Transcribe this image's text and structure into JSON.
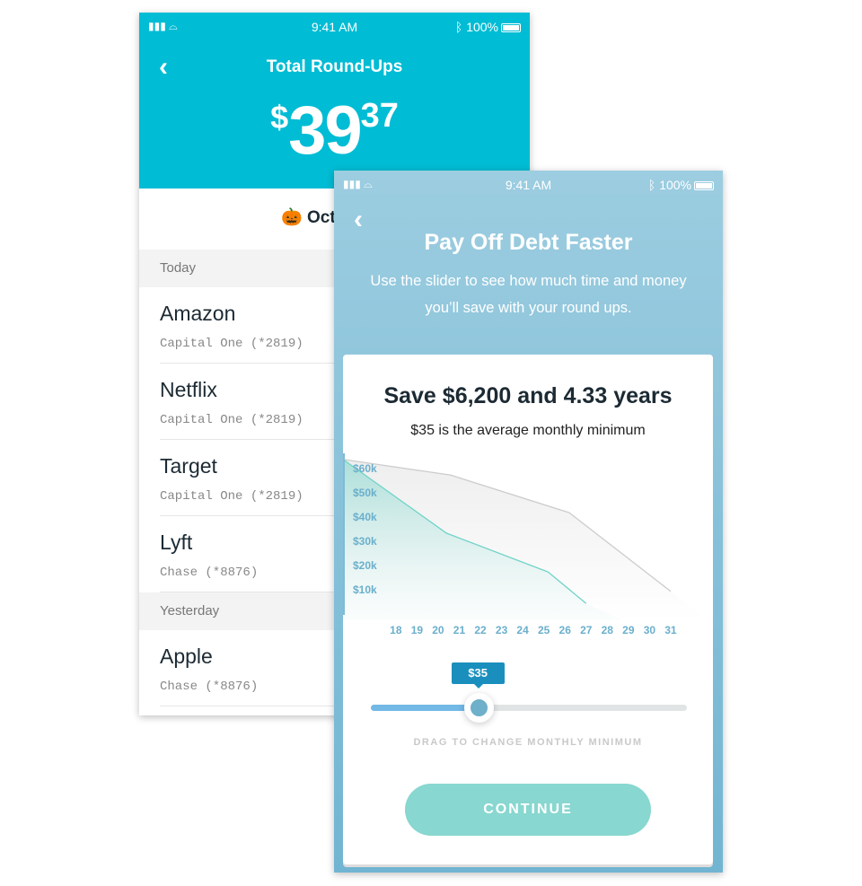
{
  "status_bar": {
    "time": "9:41 AM",
    "battery": "100%",
    "signal": "▮▮▮ ⌓",
    "bluetooth": "ᛒ"
  },
  "roundups": {
    "title": "Total Round-Ups",
    "currency": "$",
    "whole": "39",
    "cents": "37",
    "month": "Octob",
    "month_icon": "pumpkin-icon",
    "sections": [
      {
        "label": "Today",
        "items": [
          {
            "name": "Amazon",
            "account": "Capital One (*2819)"
          },
          {
            "name": "Netflix",
            "account": "Capital One (*2819)"
          },
          {
            "name": "Target",
            "account": "Capital One (*2819)"
          },
          {
            "name": "Lyft",
            "account": "Chase (*8876)"
          }
        ]
      },
      {
        "label": "Yesterday",
        "items": [
          {
            "name": "Apple",
            "account": "Chase (*8876)"
          }
        ]
      }
    ],
    "color": "#00bcd4"
  },
  "debt": {
    "title": "Pay Off Debt Faster",
    "subtitle": "Use the slider to see how much time and money you’ll save with your round ups.",
    "headline": "Save $6,200 and 4.33 years",
    "min_line": "$35 is the average monthly minimum",
    "slider": {
      "value_label": "$35",
      "fraction": 0.34,
      "caption": "DRAG TO CHANGE MONTHLY MINIMUM"
    },
    "continue_label": "CONTINUE"
  },
  "chart_data": {
    "type": "area",
    "xlim": [
      15.5,
      33
    ],
    "ylim": [
      0,
      66000
    ],
    "y_ticks": [
      "$10k",
      "$20k",
      "$30k",
      "$40k",
      "$50k",
      "$60k"
    ],
    "y_tick_values": [
      10000,
      20000,
      30000,
      40000,
      50000,
      60000
    ],
    "x_ticks": [
      "18",
      "19",
      "20",
      "21",
      "22",
      "23",
      "24",
      "25",
      "26",
      "27",
      "28",
      "29",
      "30",
      "31"
    ],
    "series": [
      {
        "color": "#cccccc",
        "points": [
          [
            15.5,
            63500
          ],
          [
            20.6,
            57000
          ],
          [
            26.2,
            41500
          ],
          [
            31,
            9000
          ]
        ]
      },
      {
        "color": "#6fd3c7",
        "points": [
          [
            15.5,
            63500
          ],
          [
            20.4,
            33000
          ],
          [
            25.2,
            17000
          ],
          [
            27,
            4000
          ]
        ]
      }
    ]
  }
}
